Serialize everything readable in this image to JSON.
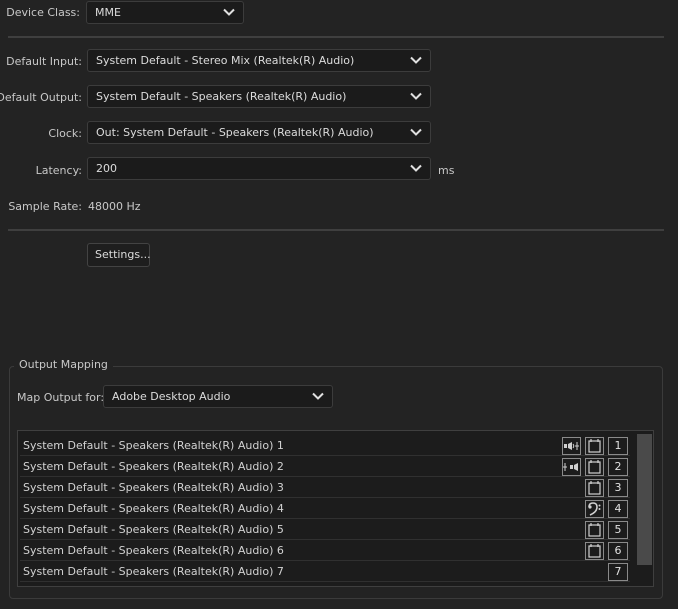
{
  "device_class": {
    "label": "Device Class:",
    "value": "MME"
  },
  "default_input": {
    "label": "Default Input:",
    "value": "System Default - Stereo Mix (Realtek(R) Audio)"
  },
  "default_output": {
    "label": "Default Output:",
    "value": "System Default - Speakers (Realtek(R) Audio)"
  },
  "clock": {
    "label": "Clock:",
    "value": "Out: System Default - Speakers (Realtek(R) Audio)"
  },
  "latency": {
    "label": "Latency:",
    "value": "200",
    "unit": "ms"
  },
  "sample_rate": {
    "label": "Sample Rate:",
    "value": "48000 Hz"
  },
  "settings_button": "Settings...",
  "output_mapping": {
    "title": "Output Mapping",
    "map_output_label": "Map Output for:",
    "map_output_value": "Adobe Desktop Audio",
    "rows": [
      {
        "name": "System Default - Speakers (Realtek(R) Audio) 1",
        "channel": "1",
        "icons": [
          "speaker-left-icon",
          "panel-assign-icon"
        ]
      },
      {
        "name": "System Default - Speakers (Realtek(R) Audio) 2",
        "channel": "2",
        "icons": [
          "speaker-right-icon",
          "panel-assign-icon"
        ]
      },
      {
        "name": "System Default - Speakers (Realtek(R) Audio) 3",
        "channel": "3",
        "icons": [
          "panel-assign-icon"
        ]
      },
      {
        "name": "System Default - Speakers (Realtek(R) Audio) 4",
        "channel": "4",
        "icons": [
          "bass-clef-icon"
        ]
      },
      {
        "name": "System Default - Speakers (Realtek(R) Audio) 5",
        "channel": "5",
        "icons": [
          "panel-assign-icon"
        ]
      },
      {
        "name": "System Default - Speakers (Realtek(R) Audio) 6",
        "channel": "6",
        "icons": [
          "panel-assign-icon"
        ]
      },
      {
        "name": "System Default - Speakers (Realtek(R) Audio) 7",
        "channel": "7",
        "icons": []
      }
    ]
  }
}
